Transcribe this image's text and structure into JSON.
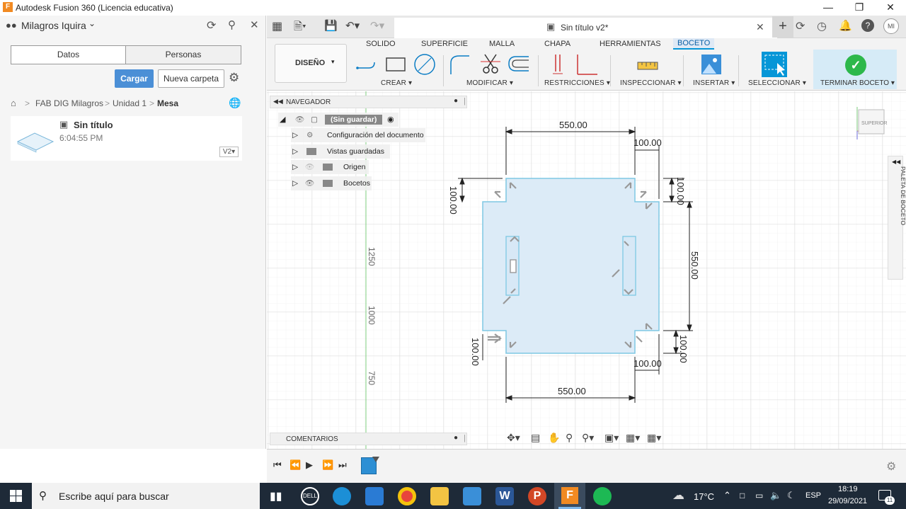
{
  "window": {
    "title": "Autodesk Fusion 360 (Licencia educativa)",
    "icon": "fusion-logo",
    "controls": [
      "minimize",
      "restore",
      "close"
    ]
  },
  "left_panel": {
    "user": "Milagros Iquira",
    "tabs": [
      "Datos",
      "Personas"
    ],
    "upload_button": "Cargar",
    "new_folder_button": "Nueva carpeta",
    "breadcrumb": [
      "FAB DIG Milagros",
      "Unidad 1",
      "Mesa"
    ],
    "file": {
      "name": "Sin título",
      "time": "6:04:55 PM",
      "version": "V2"
    }
  },
  "doc_tab": {
    "title": "Sin título v2*"
  },
  "user_initials": "MI",
  "toolbar": {
    "tabs": [
      "SOLIDO",
      "SUPERFICIE",
      "MALLA",
      "CHAPA",
      "HERRAMIENTAS",
      "BOCETO"
    ],
    "active_tab": "BOCETO",
    "workspace": "DISEÑO",
    "groups": {
      "create": "CREAR",
      "modify": "MODIFICAR",
      "constraints": "RESTRICCIONES",
      "inspect": "INSPECCIONAR",
      "insert": "INSERTAR",
      "select": "SELECCIONAR",
      "finish": "TERMINAR BOCETO"
    },
    "accent": "#0696d7",
    "finish_color": "#2db84b"
  },
  "browser": {
    "title": "NAVEGADOR",
    "root": "(Sin guardar)",
    "items": [
      "Configuración del documento",
      "Vistas guardadas",
      "Origen",
      "Bocetos"
    ]
  },
  "comments": {
    "title": "COMENTARIOS"
  },
  "sketch": {
    "ruler_labels": [
      "1250",
      "1000",
      "750"
    ],
    "dimensions": {
      "top_width": "550.00",
      "bottom_width": "550.00",
      "right_height": "550.00",
      "notch_top_right_h": "100.00",
      "notch_top_right_v": "100.00",
      "notch_top_left_v": "100.00",
      "notch_bottom_left_v": "100.00",
      "notch_bottom_right_h": "100.00",
      "notch_bottom_right_v": "100.00"
    },
    "fill_color": "#dcebf7",
    "line_color": "#7ec8e3"
  },
  "viewcube": {
    "label": "SUPERIOR"
  },
  "sketch_palette": {
    "label": "PALETA DE BOCETO"
  },
  "taskbar": {
    "search_placeholder": "Escribe aquí para buscar",
    "weather": "17°C",
    "language": "ESP",
    "time": "18:19",
    "date": "29/09/2021",
    "notifications": "11"
  }
}
